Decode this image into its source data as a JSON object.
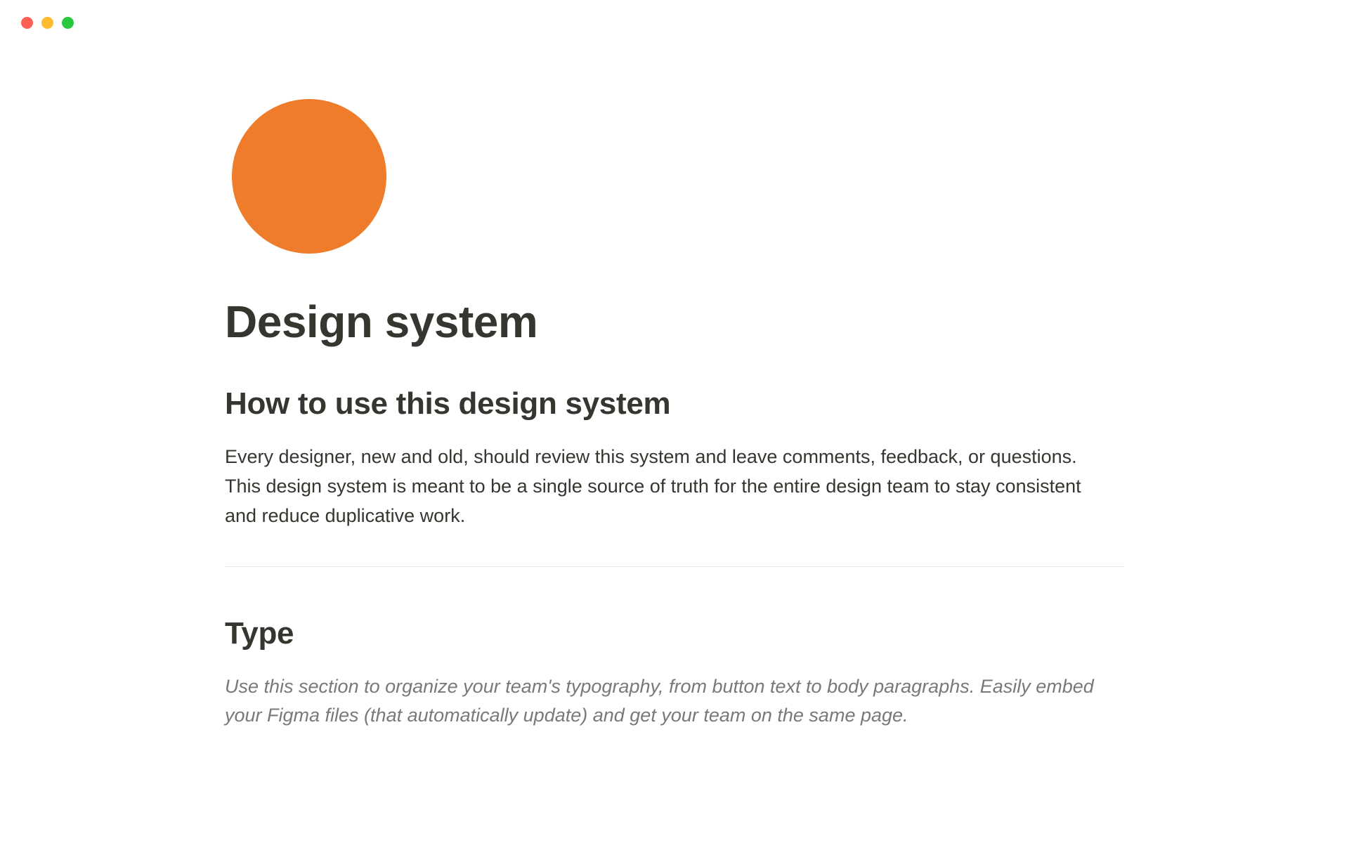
{
  "window": {
    "controls": {
      "close": "close",
      "minimize": "minimize",
      "maximize": "maximize"
    }
  },
  "page": {
    "icon_color": "#ef7c2b",
    "title": "Design system",
    "sections": [
      {
        "heading": "How to use this design system",
        "body": "Every designer, new and old, should review this system and leave comments, feedback, or questions. This design system is meant to be a single source of truth for the entire design team to stay consistent and reduce duplicative work."
      },
      {
        "heading": "Type",
        "body_italic": "Use this section to organize your team's typography, from button text to body paragraphs. Easily embed your Figma files (that automatically update) and get your team on the same page."
      }
    ]
  }
}
